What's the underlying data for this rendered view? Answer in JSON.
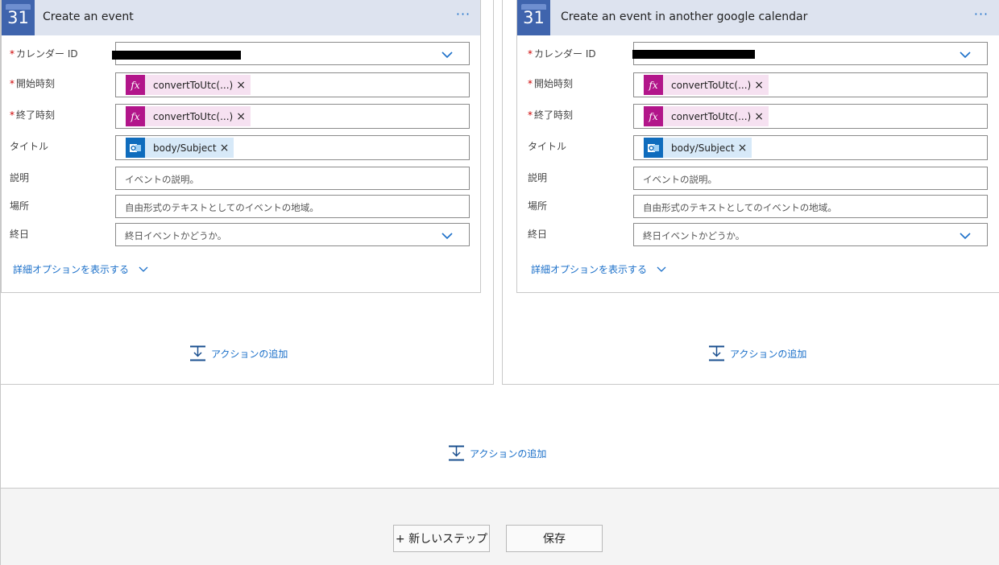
{
  "left_card": {
    "title": "Create an event",
    "icon_number": "31",
    "calendar_id_label": "カレンダー ID",
    "start_label": "開始時刻",
    "end_label": "終了時刻",
    "title_label": "タイトル",
    "desc_label": "説明",
    "location_label": "場所",
    "allday_label": "終日",
    "start_token": "convertToUtc(...)",
    "end_token": "convertToUtc(...)",
    "title_token": "body/Subject",
    "desc_placeholder": "イベントの説明。",
    "location_placeholder": "自由形式のテキストとしてのイベントの地域。",
    "allday_placeholder": "終日イベントかどうか。",
    "advanced_link": "詳細オプションを表示する",
    "add_action": "アクションの追加"
  },
  "right_card": {
    "title": "Create an event in another google calendar",
    "icon_number": "31",
    "calendar_id_label": "カレンダー ID",
    "start_label": "開始時刻",
    "end_label": "終了時刻",
    "title_label": "タイトル",
    "desc_label": "説明",
    "location_label": "場所",
    "allday_label": "終日",
    "start_token": "convertToUtc(...)",
    "end_token": "convertToUtc(...)",
    "title_token": "body/Subject",
    "desc_placeholder": "イベントの説明。",
    "location_placeholder": "自由形式のテキストとしてのイベントの地域。",
    "allday_placeholder": "終日イベントかどうか。",
    "advanced_link": "詳細オプションを表示する",
    "add_action": "アクションの追加"
  },
  "required_marker": "*",
  "more_menu": "···",
  "token_remove": "×",
  "outer_add_action": "アクションの追加",
  "new_step_button": "+ 新しいステップ",
  "save_button": "保存",
  "colors": {
    "accent": "#1a6fc9",
    "header_bg": "#dde3ef",
    "calendar_icon": "#3f64ad",
    "fx_token": "#b2158a",
    "outlook_token": "#0f6cbd"
  },
  "icons": {
    "calendar": "google-calendar-icon",
    "expression": "fx-icon",
    "outlook": "outlook-icon",
    "chevron": "chevron-down-icon",
    "add_action": "add-action-icon"
  }
}
